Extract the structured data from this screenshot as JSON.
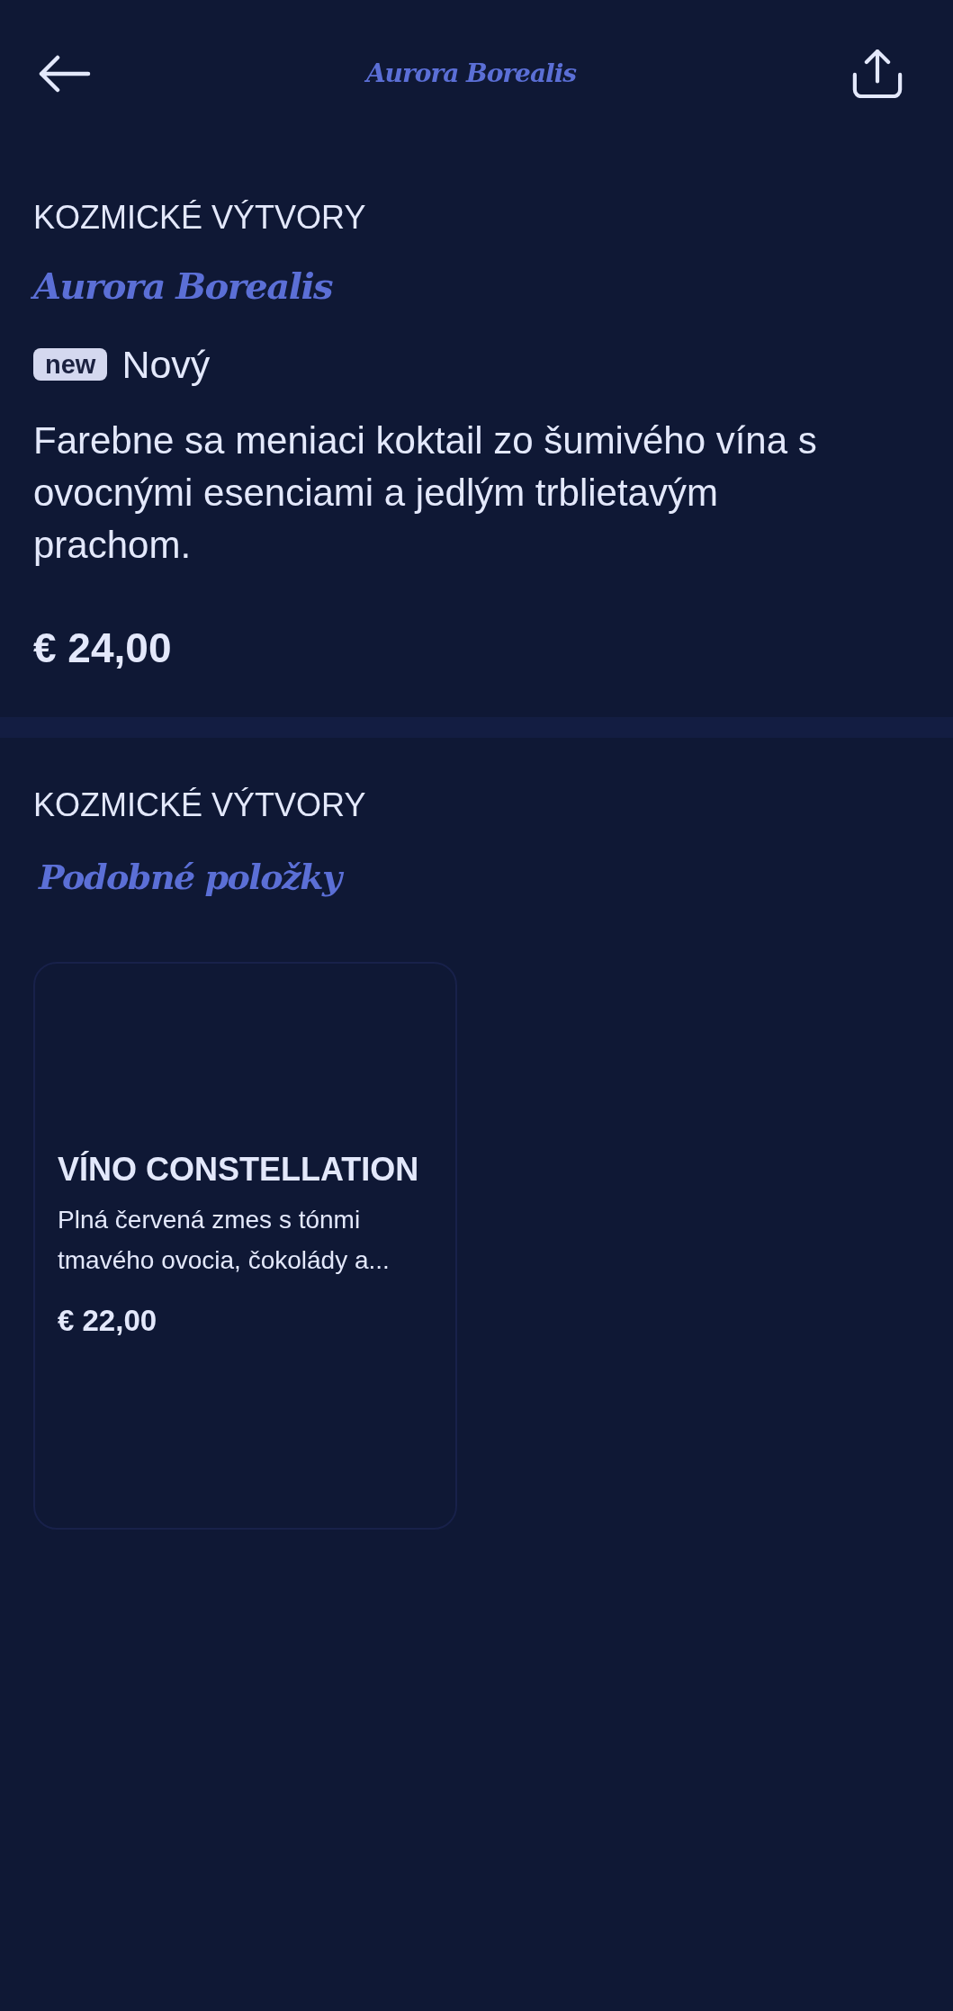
{
  "header": {
    "title": "Aurora Borealis"
  },
  "product": {
    "category": "KOZMICKÉ VÝTVORY",
    "name": "Aurora Borealis",
    "badge": {
      "label": "new",
      "text": "Nový"
    },
    "description": "Farebne sa meniaci koktail zo šumivého vína s ovocnými esenciami a jedlým trblietavým prachom.",
    "price": "€ 24,00"
  },
  "similar": {
    "category": "KOZMICKÉ VÝTVORY",
    "heading": "Podobné položky",
    "items": [
      {
        "name": "VÍNO CONSTELLATION",
        "description": "Plná červená zmes s tónmi tmavého ovocia, čokolády a...",
        "price": "€ 22,00"
      }
    ]
  }
}
